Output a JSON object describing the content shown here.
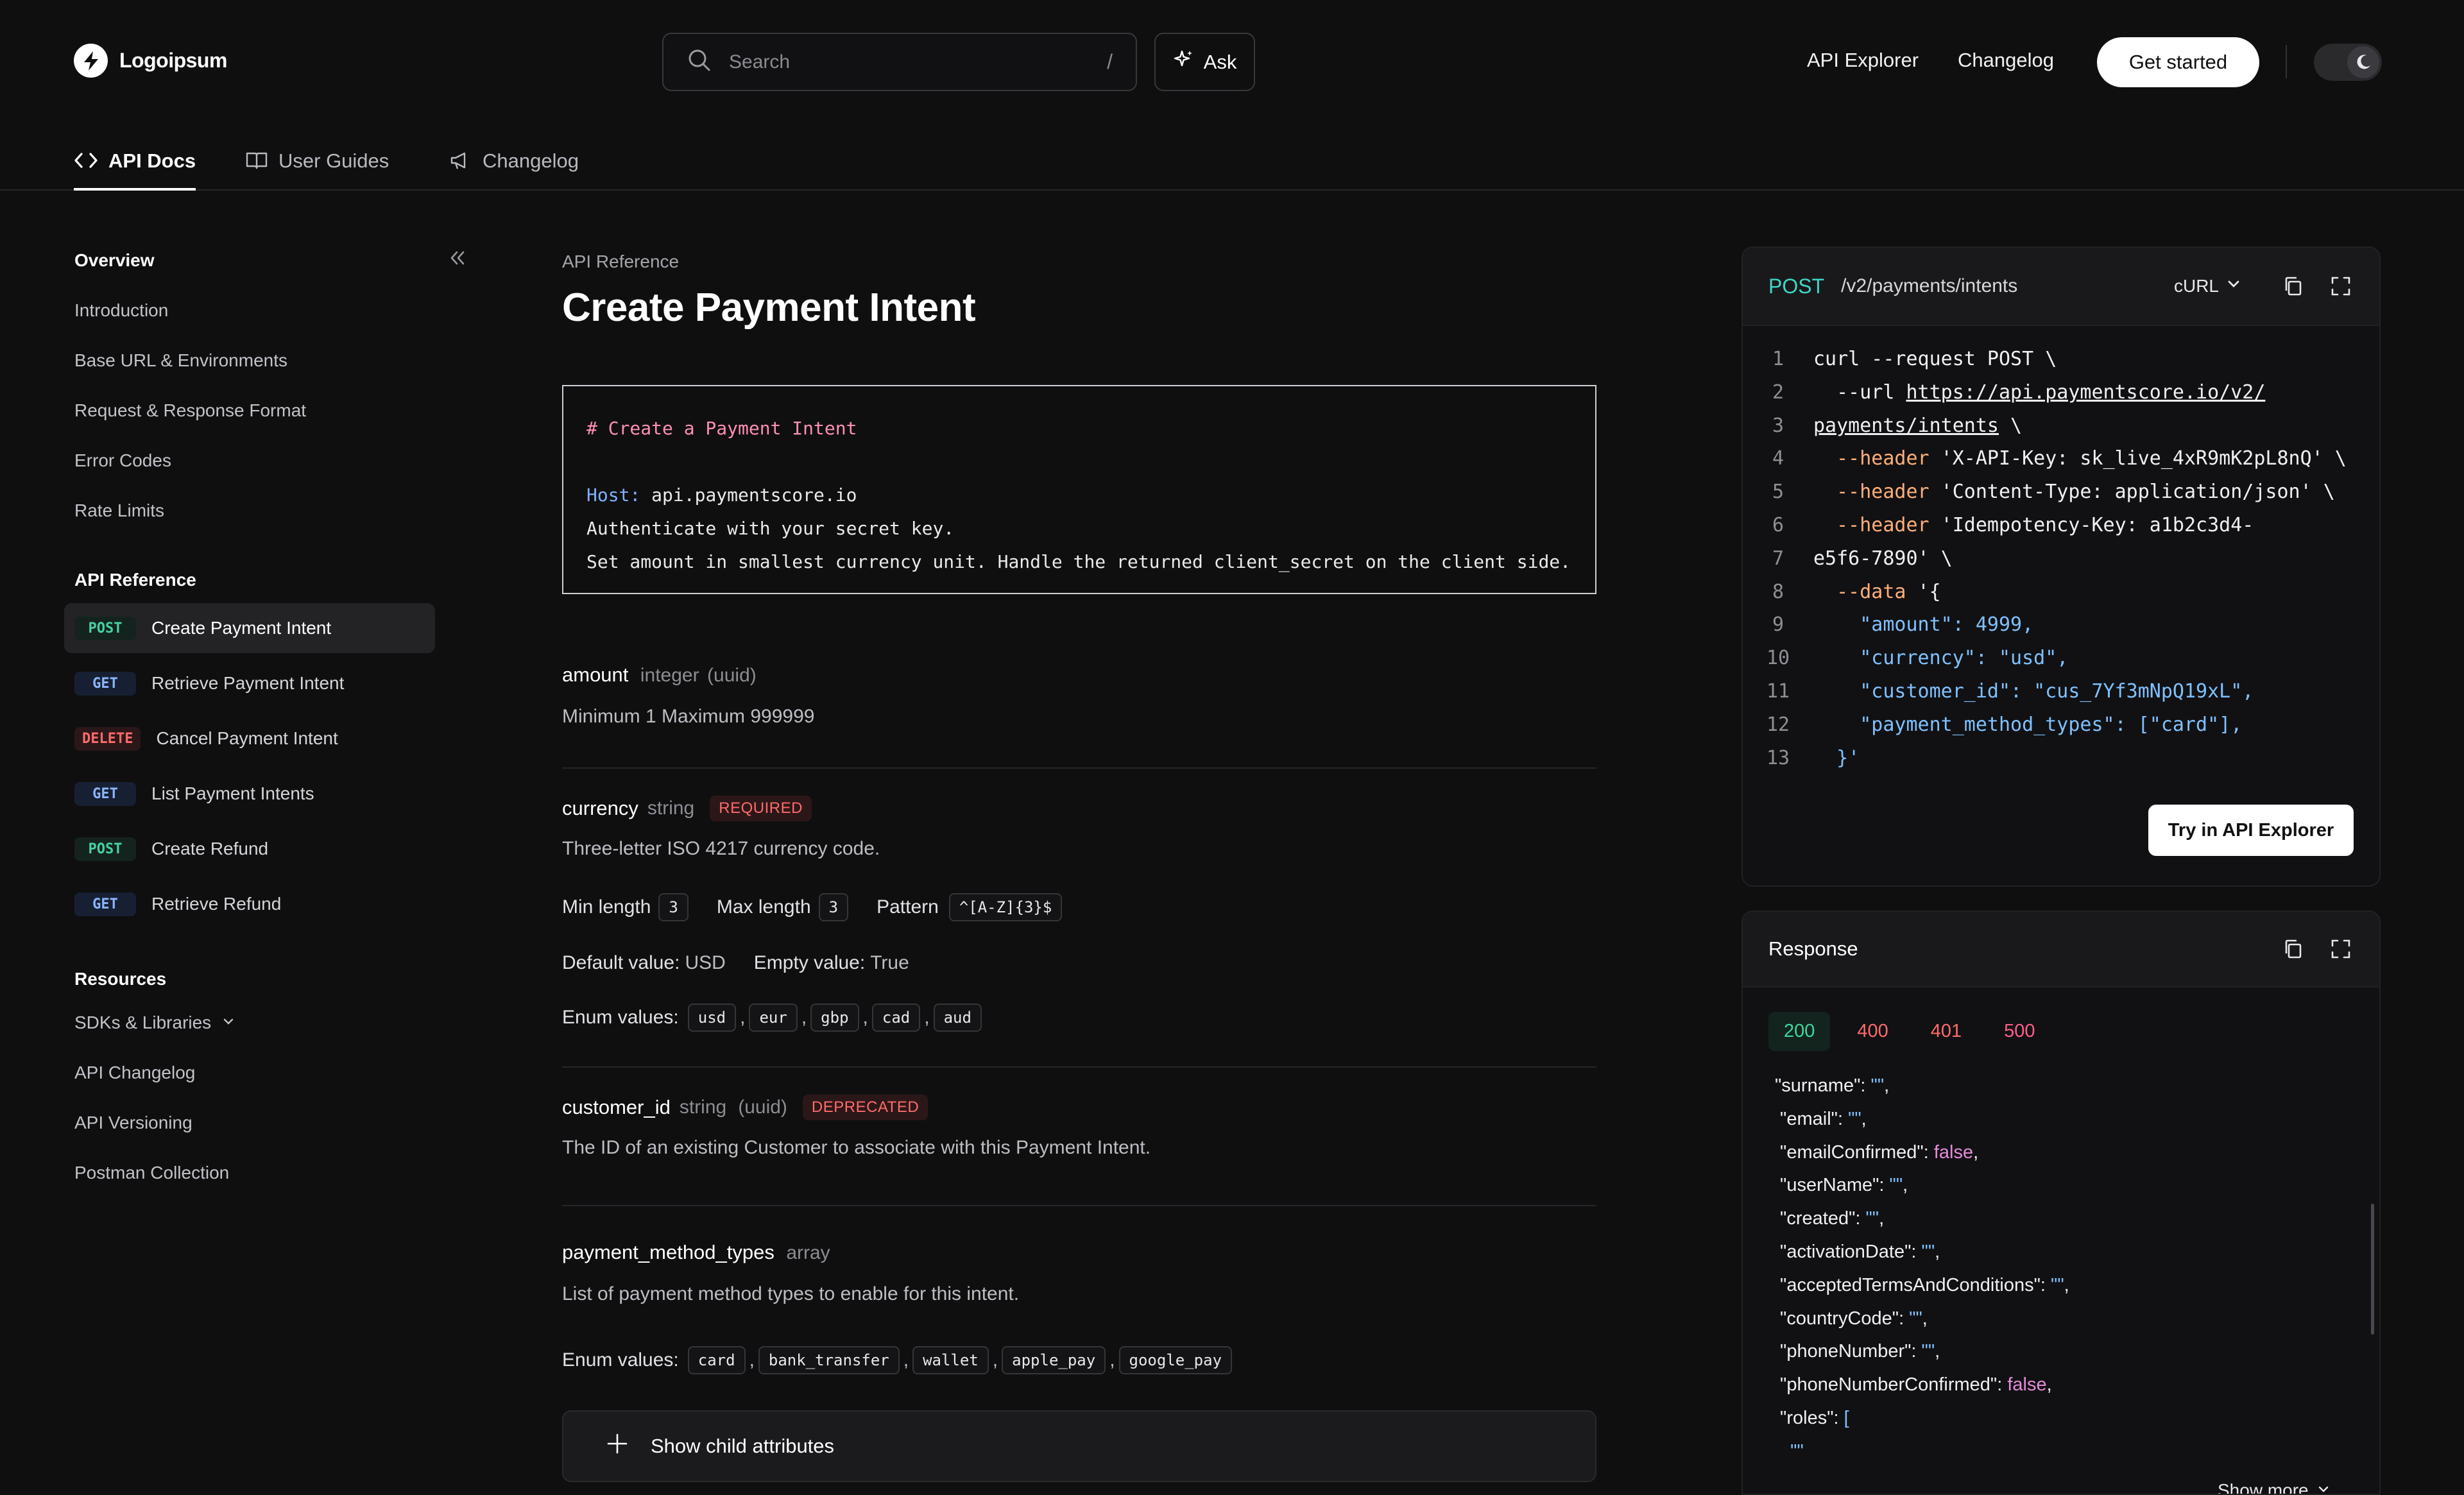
{
  "header": {
    "logo_text": "Logoipsum",
    "search_placeholder": "Search",
    "search_shortcut": "/",
    "ask_label": "Ask",
    "nav": [
      "API Explorer",
      "Changelog"
    ],
    "cta_label": "Get started"
  },
  "tabs": [
    {
      "label": "API Docs",
      "active": true
    },
    {
      "label": "User Guides",
      "active": false
    },
    {
      "label": "Changelog",
      "active": false
    }
  ],
  "sidebar": {
    "overview_title": "Overview",
    "overview_links": [
      "Introduction",
      "Base URL & Environments",
      "Request & Response Format",
      "Error Codes",
      "Rate Limits"
    ],
    "api_title": "API Reference",
    "api_items": [
      {
        "method": "POST",
        "label": "Create Payment Intent"
      },
      {
        "method": "GET",
        "label": "Retrieve Payment Intent"
      },
      {
        "method": "DELETE",
        "label": "Cancel Payment Intent"
      },
      {
        "method": "GET",
        "label": "List Payment Intents"
      },
      {
        "method": "POST",
        "label": "Create Refund"
      },
      {
        "method": "GET",
        "label": "Retrieve Refund"
      }
    ],
    "resources_title": "Resources",
    "resources_links": [
      "SDKs & Libraries",
      "API Changelog",
      "API Versioning",
      "Postman Collection"
    ]
  },
  "main": {
    "breadcrumb": "API Reference",
    "title": "Create Payment Intent",
    "intro": {
      "comment": "# Create a Payment Intent",
      "host_key": "Host:",
      "host_val": " api.paymentscore.io",
      "line1": "Authenticate with your secret key.",
      "line2": "Set amount in smallest currency unit. Handle the returned client_secret on the client side."
    },
    "amount": {
      "name": "amount",
      "type": "integer",
      "format": "(uuid)",
      "desc": "Minimum 1 Maximum 999999"
    },
    "currency": {
      "name": "currency",
      "type": "string",
      "tag": "REQUIRED",
      "desc": "Three-letter ISO 4217 currency code.",
      "min_label": "Min length",
      "min_val": "3",
      "max_label": "Max length",
      "max_val": "3",
      "pattern_label": "Pattern",
      "pattern_val": "^[A-Z]{3}$",
      "default_label": "Default value:",
      "default_val": "USD",
      "empty_label": "Empty value:",
      "empty_val": "True",
      "enum_label": "Enum values:",
      "enum": [
        "usd",
        "eur",
        "gbp",
        "cad",
        "aud"
      ]
    },
    "customer_id": {
      "name": "customer_id",
      "type": "string",
      "format": "(uuid)",
      "tag": "DEPRECATED",
      "desc": "The ID of an existing Customer to associate with this Payment Intent."
    },
    "payment_method_types": {
      "name": "payment_method_types",
      "type": "array",
      "desc": "List of payment method types to enable for this intent.",
      "enum_label": "Enum values:",
      "enum": [
        "card",
        "bank_transfer",
        "wallet",
        "apple_pay",
        "google_pay"
      ]
    },
    "show_child_label": "Show child attributes"
  },
  "request": {
    "method": "POST",
    "path": "/v2/payments/intents",
    "lang": "cURL",
    "try_label": "Try in API Explorer"
  },
  "response": {
    "title": "Response",
    "codes": [
      "200",
      "400",
      "401",
      "500"
    ],
    "show_more": "Show more"
  },
  "colors": {
    "post": "#44d3a0",
    "get": "#8cb6ff",
    "delete": "#ff6b6b",
    "accent": "#3fd6c6"
  }
}
